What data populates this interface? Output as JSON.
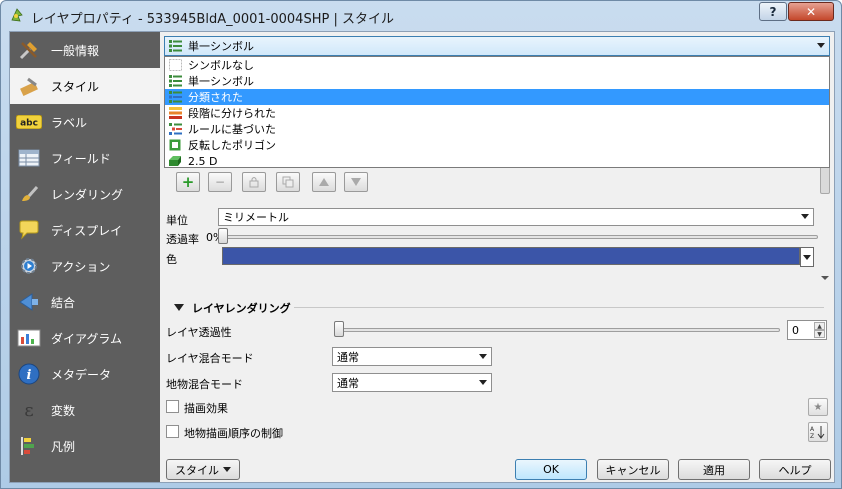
{
  "window": {
    "title": "レイヤプロパティ - 533945BldA_0001-0004SHP | スタイル",
    "help_label": "?",
    "close_label": "✕"
  },
  "sidebar": {
    "items": [
      {
        "label": "一般情報",
        "icon": "tools-icon"
      },
      {
        "label": "スタイル",
        "icon": "brush-icon"
      },
      {
        "label": "ラベル",
        "icon": "abc-label-icon"
      },
      {
        "label": "フィールド",
        "icon": "table-icon"
      },
      {
        "label": "レンダリング",
        "icon": "paintbrush-icon"
      },
      {
        "label": "ディスプレイ",
        "icon": "speech-bubble-icon"
      },
      {
        "label": "アクション",
        "icon": "gear-play-icon"
      },
      {
        "label": "結合",
        "icon": "join-icon"
      },
      {
        "label": "ダイアグラム",
        "icon": "diagram-icon"
      },
      {
        "label": "メタデータ",
        "icon": "info-icon"
      },
      {
        "label": "変数",
        "icon": "epsilon-icon"
      },
      {
        "label": "凡例",
        "icon": "legend-icon"
      }
    ],
    "active_index": 1
  },
  "renderer": {
    "selected": "単一シンボル",
    "options": [
      "シンボルなし",
      "単一シンボル",
      "分類された",
      "段階に分けられた",
      "ルールに基づいた",
      "反転したポリゴン",
      "2.5 D"
    ],
    "highlighted_index": 2
  },
  "symbol": {
    "unit_label": "単位",
    "unit_value": "ミリメートル",
    "transparency_label": "透過率",
    "transparency_value": "0%",
    "color_label": "色",
    "color_value": "#3b55a8"
  },
  "layer_rendering": {
    "section_title": "レイヤレンダリング",
    "layer_transparency_label": "レイヤ透過性",
    "layer_transparency_value": "0",
    "layer_blend_label": "レイヤ混合モード",
    "layer_blend_value": "通常",
    "feature_blend_label": "地物混合モード",
    "feature_blend_value": "通常",
    "draw_effects_label": "描画効果",
    "control_order_label": "地物描画順序の制御"
  },
  "buttons": {
    "style": "スタイル",
    "ok": "OK",
    "cancel": "キャンセル",
    "apply": "適用",
    "help": "ヘルプ"
  }
}
